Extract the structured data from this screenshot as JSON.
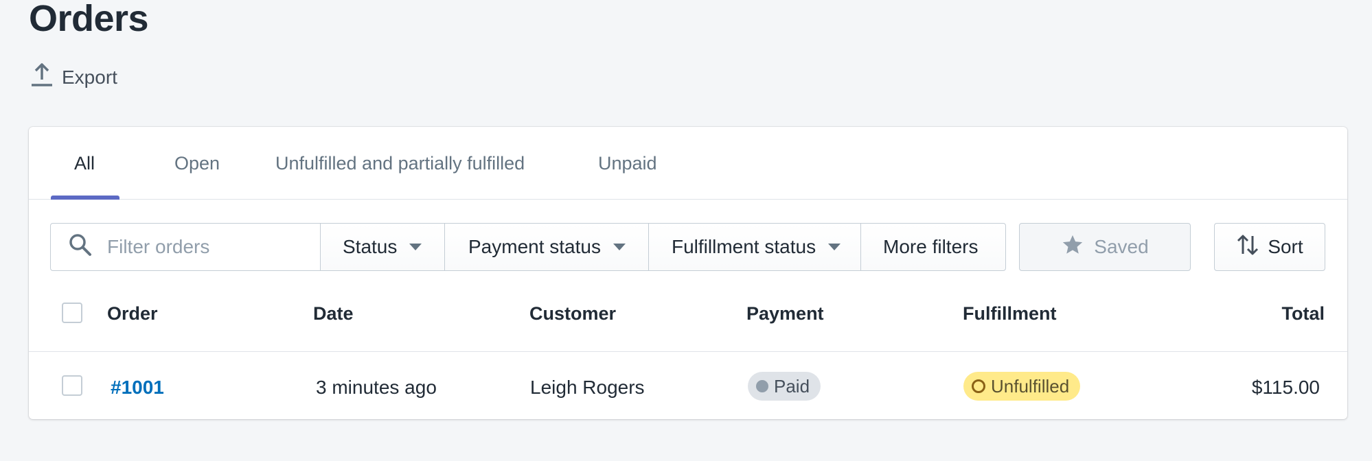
{
  "page": {
    "title": "Orders",
    "export_label": "Export"
  },
  "tabs": [
    {
      "label": "All",
      "active": true
    },
    {
      "label": "Open"
    },
    {
      "label": "Unfulfilled and partially fulfilled"
    },
    {
      "label": "Unpaid"
    }
  ],
  "filters": {
    "search_placeholder": "Filter orders",
    "status": "Status",
    "payment_status": "Payment status",
    "fulfillment_status": "Fulfillment status",
    "more_filters": "More filters",
    "saved": "Saved",
    "sort": "Sort"
  },
  "table": {
    "columns": [
      "Order",
      "Date",
      "Customer",
      "Payment",
      "Fulfillment",
      "Total"
    ],
    "rows": [
      {
        "order": "#1001",
        "date": "3 minutes ago",
        "customer": "Leigh Rogers",
        "payment": "Paid",
        "fulfillment": "Unfulfilled",
        "total": "$115.00"
      }
    ]
  },
  "colors": {
    "accent": "#5c6ac4",
    "link": "#006fbb",
    "paid_badge": "#dfe3e8",
    "unfulfilled_badge": "#ffea8a"
  }
}
